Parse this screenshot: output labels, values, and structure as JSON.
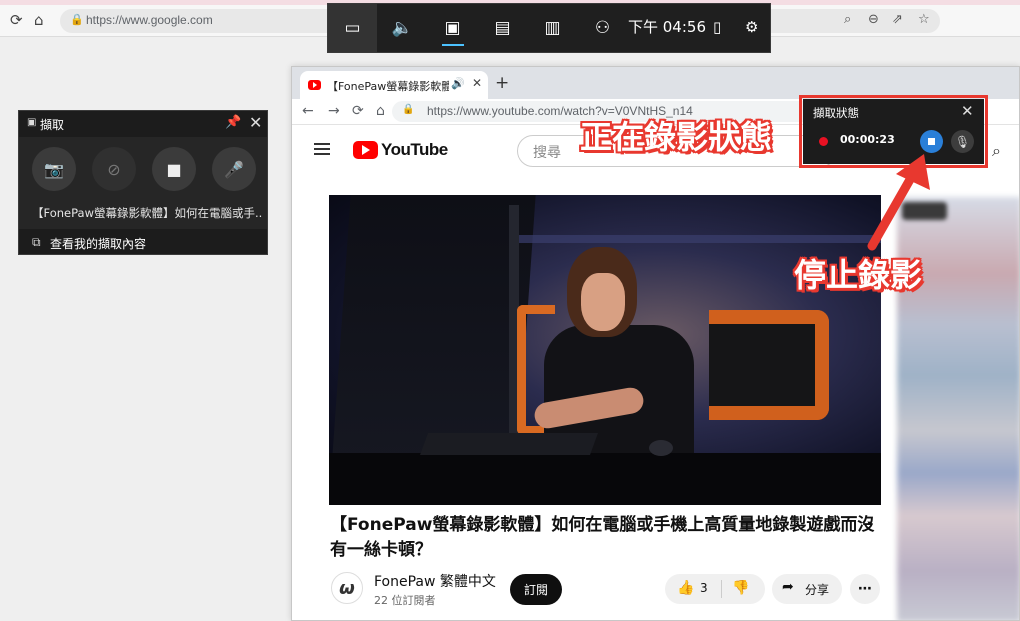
{
  "background_browser": {
    "url": "https://www.google.com"
  },
  "gamebar": {
    "time": "下午 04:56",
    "icons": [
      "widget-menu-icon",
      "audio-icon",
      "capture-icon",
      "performance-icon",
      "resources-icon",
      "social-icon"
    ]
  },
  "capture_widget": {
    "title": "擷取",
    "video_label": "【FonePaw螢幕錄影軟體】如何在電腦或手...",
    "footer_link": "查看我的擷取內容"
  },
  "youtube_window": {
    "tab_title": "【FonePaw螢幕錄影軟體】如",
    "new_tab": "+",
    "url": "https://www.youtube.com/watch?v=V0VNtHS_n14",
    "brand": "YouTube",
    "search_placeholder": "搜尋",
    "video_title": "【FonePaw螢幕錄影軟體】如何在電腦或手機上高質量地錄製遊戲而沒有一絲卡頓？",
    "channel_name": "FonePaw 繁體中文",
    "channel_avatar": "ω",
    "subscriber_count": "22 位訂閱者",
    "subscribe_label": "訂閱",
    "like_count": "3",
    "share_label": "分享"
  },
  "recording_widget": {
    "title": "擷取狀態",
    "timer": "00:00:23"
  },
  "annotations": {
    "recording_state": "正在錄影狀態",
    "stop_recording": "停止錄影",
    "highlight_color": "#e8382f"
  }
}
